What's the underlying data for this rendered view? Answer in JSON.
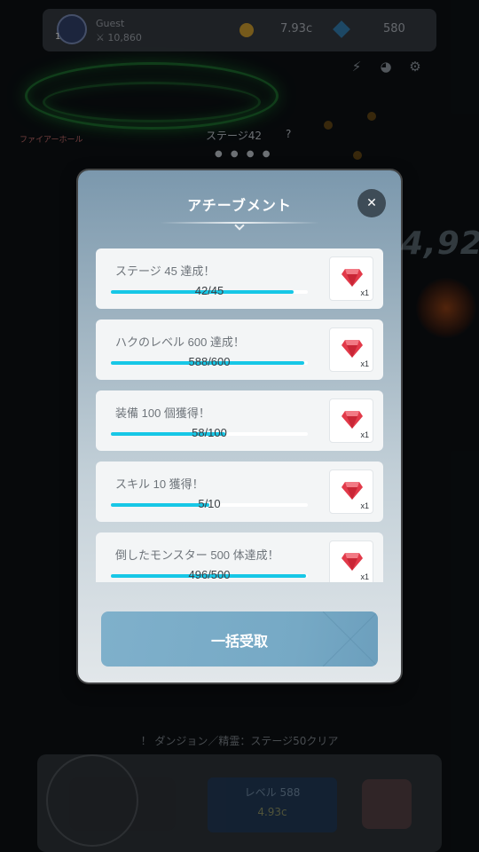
{
  "header": {
    "player_name": "Guest",
    "player_level": "1",
    "power": "⚔ 10,860",
    "gold": "7.93c",
    "gems": "580"
  },
  "stage": {
    "mode_label": "ファイアーホール",
    "title": "ステージ42",
    "help": "?",
    "pager": "● ● ● ●"
  },
  "background": {
    "damage_number": "4,92",
    "quest_text": "！ ダンジョン／精霊：ステージ50クリア",
    "level_button_label": "レベル 588",
    "level_button_cost": "4.93c"
  },
  "modal": {
    "title": "アチーブメント",
    "close_label": "✕",
    "claim_all_label": "一括受取"
  },
  "achievements": [
    {
      "title": "ステージ 45 達成！",
      "progress_text": "42/45",
      "progress": 0.93,
      "reward_qty": "x1"
    },
    {
      "title": "ハクのレベル 600 達成！",
      "progress_text": "588/600",
      "progress": 0.98,
      "reward_qty": "x1"
    },
    {
      "title": "装備 100 個獲得！",
      "progress_text": "58/100",
      "progress": 0.58,
      "reward_qty": "x1"
    },
    {
      "title": "スキル 10 獲得！",
      "progress_text": "5/10",
      "progress": 0.5,
      "reward_qty": "x1"
    },
    {
      "title": "倒したモンスター 500 体達成！",
      "progress_text": "496/500",
      "progress": 0.99,
      "reward_qty": "x1"
    }
  ],
  "colors": {
    "progress_fill": "#17c7e6",
    "gem_red": "#e23a4a",
    "claim_button": "#7fb0cb"
  },
  "icons": {
    "reward": "red-gem-icon",
    "close": "close-icon"
  }
}
